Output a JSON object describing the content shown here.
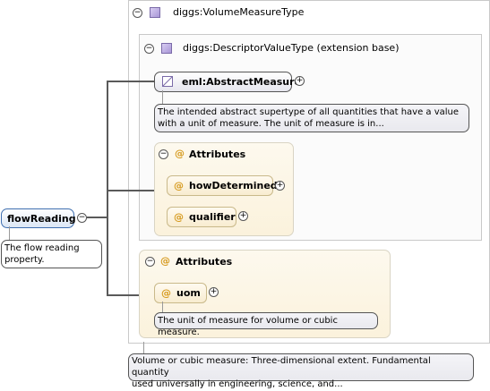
{
  "root": {
    "name": "flowReading",
    "doc": [
      "The flow reading",
      "property."
    ]
  },
  "type": {
    "name": "diggs:VolumeMeasureType",
    "doc": [
      "Volume or cubic measure: Three-dimensional extent. Fundamental quantity",
      "used universally in engineering, science, and..."
    ]
  },
  "base": {
    "name": "diggs:DescriptorValueType (extension base)"
  },
  "abstract": {
    "name": "eml:AbstractMeasure",
    "doc": [
      "The intended abstract supertype of all quantities that have a value",
      "with a unit of measure. The unit of measure is in..."
    ]
  },
  "inner_attributes": {
    "title": "Attributes",
    "items": [
      "howDetermined",
      "qualifier"
    ]
  },
  "outer_attributes": {
    "title": "Attributes",
    "items": [
      "uom"
    ],
    "uom_doc": "The unit of measure for volume or cubic measure."
  },
  "symbols": {
    "collapse": "⊖",
    "expand": "⊕",
    "attr": "@"
  }
}
